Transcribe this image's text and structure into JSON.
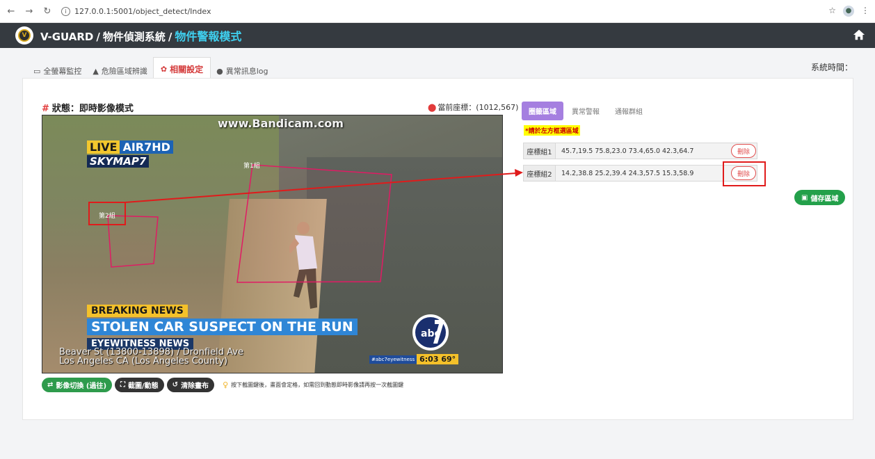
{
  "browser": {
    "url": "127.0.0.1:5001/object_detect/Index"
  },
  "appbar": {
    "brand": "V-GUARD",
    "system": "物件偵測系統",
    "mode": "物件警報模式"
  },
  "tabs": [
    {
      "label": "全螢幕監控",
      "icon": "monitor-icon"
    },
    {
      "label": "危險區域辨識",
      "icon": "warning-icon"
    },
    {
      "label": "相關設定",
      "icon": "gear-icon"
    },
    {
      "label": "異常訊息log",
      "icon": "chat-icon"
    }
  ],
  "system_time_label": "系統時間：",
  "status": {
    "hash": "#",
    "title": "狀態：即時影像模式",
    "coords": "當前座標：(1012,567)"
  },
  "video": {
    "watermark": "www.Bandicam.com",
    "live": "LIVE",
    "air": "AIR7HD",
    "skymap": "SKYMAP7",
    "breaking": "BREAKING NEWS",
    "headline": "STOLEN CAR SUSPECT ON THE RUN",
    "eyewitness": "EYEWITNESS NEWS",
    "location1": "Beaver St (13800-13898) / Dronfield Ave",
    "location2": "Los Angeles CA (Los Angeles County)",
    "hashtag": "#abc7eyewitness",
    "time": "6:03",
    "temp": "69°",
    "zone1_label": "第1組",
    "zone2_label": "第2組"
  },
  "buttons": {
    "switch": "影像切換 (過往)",
    "snapshot": "截圖/動態",
    "clear": "清除畫布",
    "hint": "按下截圖鍵後，畫面會定格，如需回到動態即時影像請再按一次截圖鍵"
  },
  "panel": {
    "tabs": [
      "圈籤區域",
      "異常警報",
      "通報群組"
    ],
    "note": "*請於左方框選區域",
    "rows": [
      {
        "label": "座標組1",
        "value": "45.7,19.5 75.8,23.0 73.4,65.0 42.3,64.7",
        "delete": "刪除"
      },
      {
        "label": "座標組2",
        "value": "14.2,38.8 25.2,39.4 24.3,57.5 15.3,58.9",
        "delete": "刪除"
      }
    ],
    "save": "儲存區域"
  },
  "colors": {
    "appbar": "#353a40",
    "mode_accent": "#3fd0f0",
    "active_tab": "#d43a3a",
    "panel_tab": "#a57fe0",
    "annotation_red": "#e01b1b",
    "save_green": "#23a04a"
  }
}
